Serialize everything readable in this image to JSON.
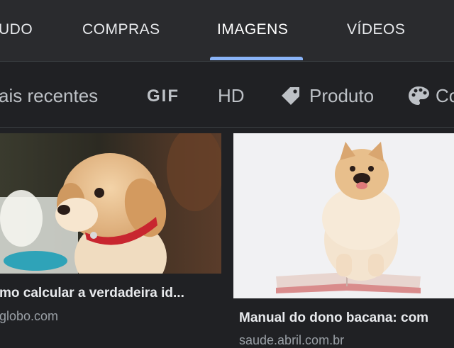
{
  "tabs": [
    {
      "label": "UDO"
    },
    {
      "label": "COMPRAS"
    },
    {
      "label": "IMAGENS",
      "active": true
    },
    {
      "label": "VÍDEOS"
    }
  ],
  "filters": {
    "recent": "ais recentes",
    "gif": "GIF",
    "hd": "HD",
    "product": "Produto",
    "color": "Co"
  },
  "results": [
    {
      "title": "mo calcular a verdadeira id...",
      "source": "globo.com"
    },
    {
      "title": "Manual do dono bacana: com",
      "source": "saude.abril.com.br"
    }
  ],
  "colors": {
    "background": "#202124",
    "tabbar": "#2a2b2e",
    "accent": "#8ab4f8",
    "text": "#e8eaed",
    "muted": "#9aa0a6"
  },
  "icons": {
    "product": "tag-icon",
    "color": "palette-icon"
  }
}
